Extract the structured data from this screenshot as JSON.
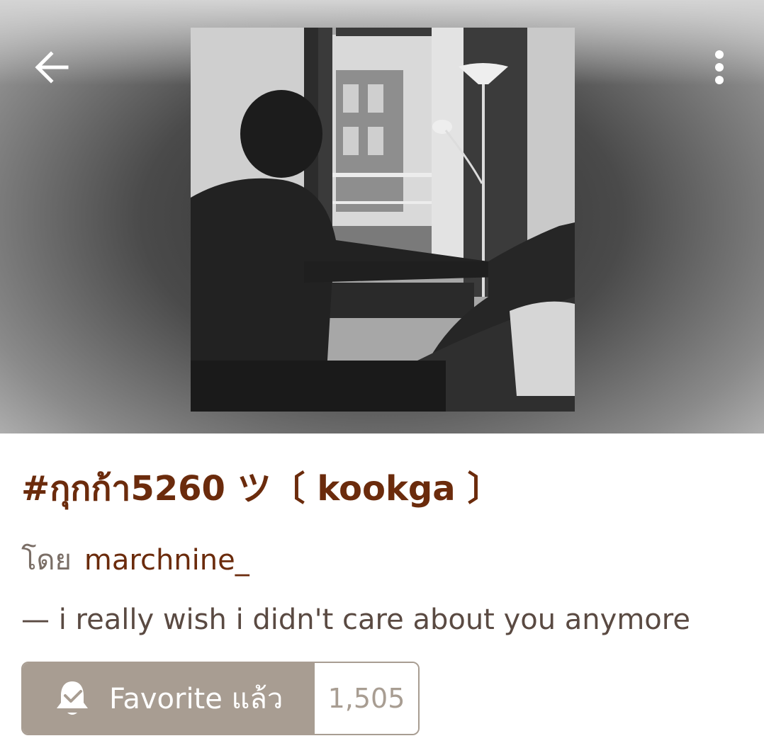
{
  "header": {
    "back_icon": "arrow-left-icon",
    "menu_icon": "more-vertical-icon",
    "cover_image": "black-and-white photo of two people by a window"
  },
  "story": {
    "title": "#กุกก้า5260 ツ〔  kookga  〕",
    "by_label": "โดย",
    "author": "marchnine_",
    "description": "— i really wish i didn't care about you anymore"
  },
  "favorite": {
    "icon": "bell-check-icon",
    "label": "Favorite แล้ว",
    "count": "1,505"
  },
  "colors": {
    "title": "#6b2b0c",
    "favorite_bg": "#a89d92",
    "text": "#5a4a42"
  }
}
